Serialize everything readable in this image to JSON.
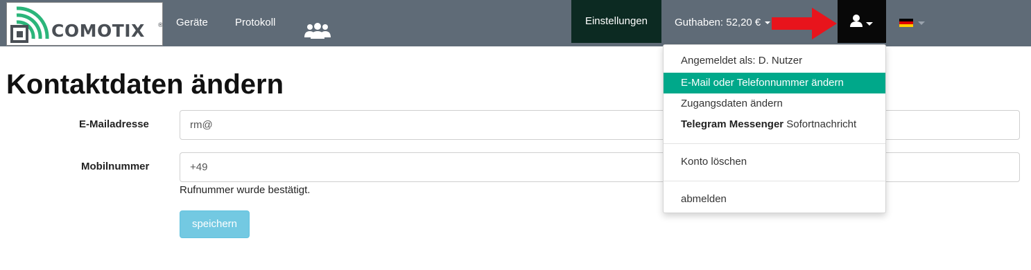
{
  "brand": {
    "name": "COMOTIX",
    "reg_mark": "®"
  },
  "nav": {
    "geraete": "Geräte",
    "protokoll": "Protokoll",
    "users_icon": "users-group-icon",
    "einstellungen": "Einstellungen",
    "guthaben": "Guthaben: 52,20 €",
    "user_icon": "user-icon",
    "language_flag": "german-flag-icon"
  },
  "page": {
    "title": "Kontaktdaten ändern",
    "email_label": "E-Mailadresse",
    "email_value": "rm@",
    "mobile_label": "Mobilnummer",
    "mobile_value": "+49",
    "mobile_help": "Rufnummer wurde bestätigt.",
    "save_label": "speichern"
  },
  "dropdown": {
    "logged_in": "Angemeldet als: D. Nutzer",
    "change_contact": "E-Mail oder Telefonnummer ändern",
    "change_access": "Zugangsdaten ändern",
    "telegram_bold": "Telegram Messenger",
    "telegram_rest": " Sofortnachricht",
    "delete_account": "Konto löschen",
    "logout": "abmelden"
  },
  "colors": {
    "navbar": "#5f6b77",
    "active_nav": "#0c2a22",
    "user_nav": "#080808",
    "dropdown_active": "#00a88a",
    "save_button": "#5bc0de",
    "annotation_arrow": "#e8141c",
    "logo_green": "#2bb57a"
  }
}
